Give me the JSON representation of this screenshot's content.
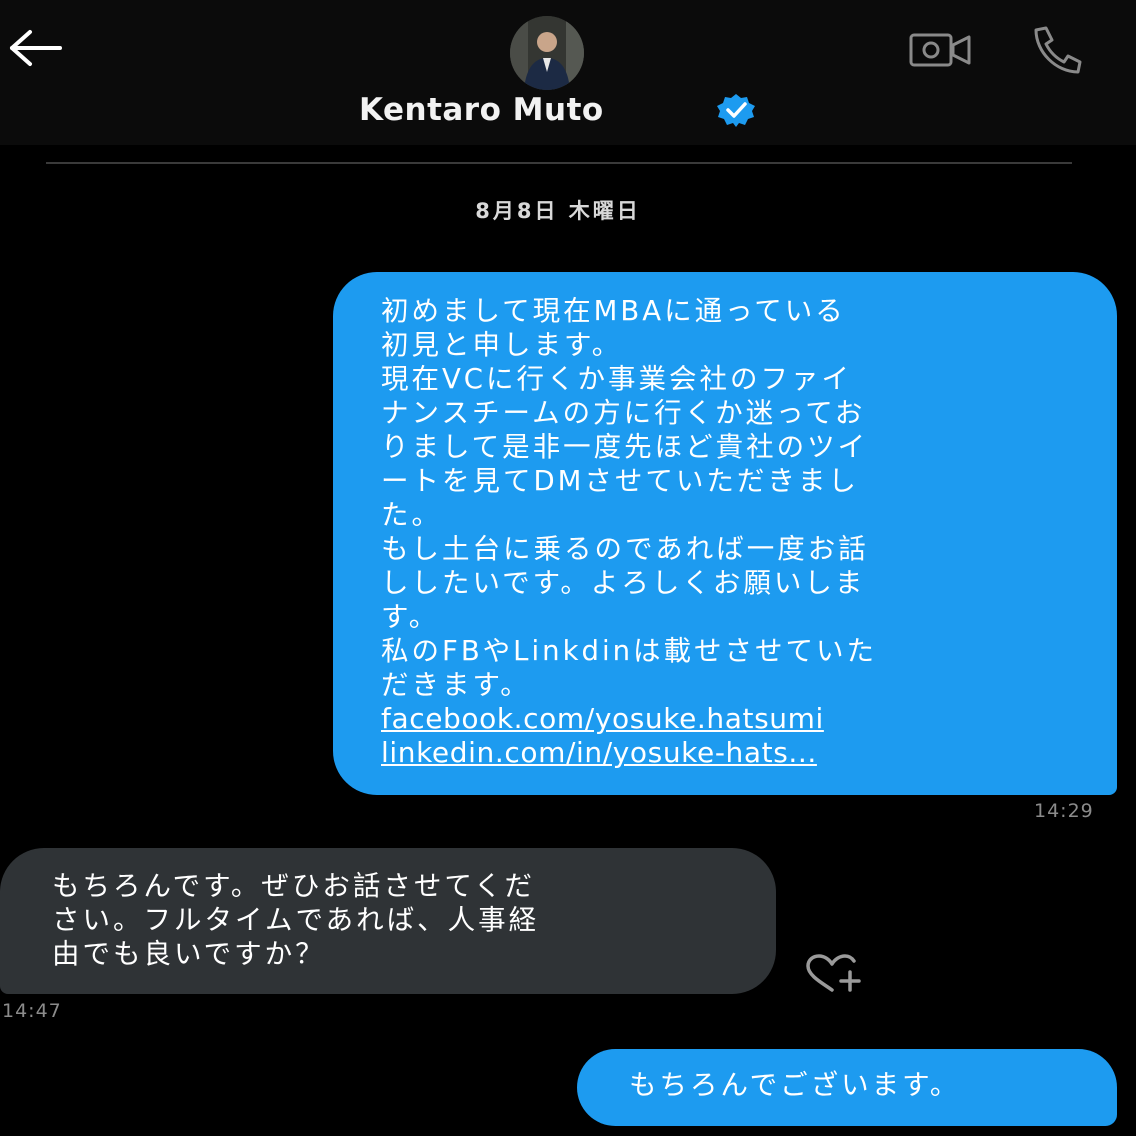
{
  "header": {
    "back_icon": "arrow-left-icon",
    "contact_name": "Kentaro Muto",
    "verified_icon": "verified-badge-icon",
    "video_icon": "video-camera-icon",
    "call_icon": "phone-icon"
  },
  "conversation": {
    "date_separator": "8月8日 木曜日",
    "messages": [
      {
        "sender": "me",
        "lines": [
          "初めまして現在MBAに通っている",
          "初見と申します。",
          "現在VCに行くか事業会社のファイ",
          "ナンスチームの方に行くか迷ってお",
          "りまして是非一度先ほど貴社のツイ",
          "ートを見てDMさせていただきまし",
          "た。",
          "もし土台に乗るのであれば一度お話",
          "ししたいです。よろしくお願いしま",
          "す。",
          "私のFBやLinkdinは載せさせていた",
          "だきます。"
        ],
        "links": [
          "facebook.com/yosuke.hatsumi",
          "linkedin.com/in/yosuke-hats..."
        ],
        "time": "14:29"
      },
      {
        "sender": "them",
        "lines": [
          "もちろんです。ぜひお話させてくだ",
          "さい。フルタイムであれば、人事経",
          "由でも良いですか？"
        ],
        "time": "14:47",
        "reaction_icon": "heart-plus-icon"
      },
      {
        "sender": "me",
        "lines": [
          "もちろんでございます。"
        ]
      }
    ]
  },
  "colors": {
    "background": "#000000",
    "header_background": "#0b0b0b",
    "sent_bubble": "#1d9bf0",
    "received_bubble": "#2f3336",
    "timestamp": "#8b8b8b",
    "icon_gray": "#8a8a8a",
    "verified_blue": "#1d9bf0"
  }
}
